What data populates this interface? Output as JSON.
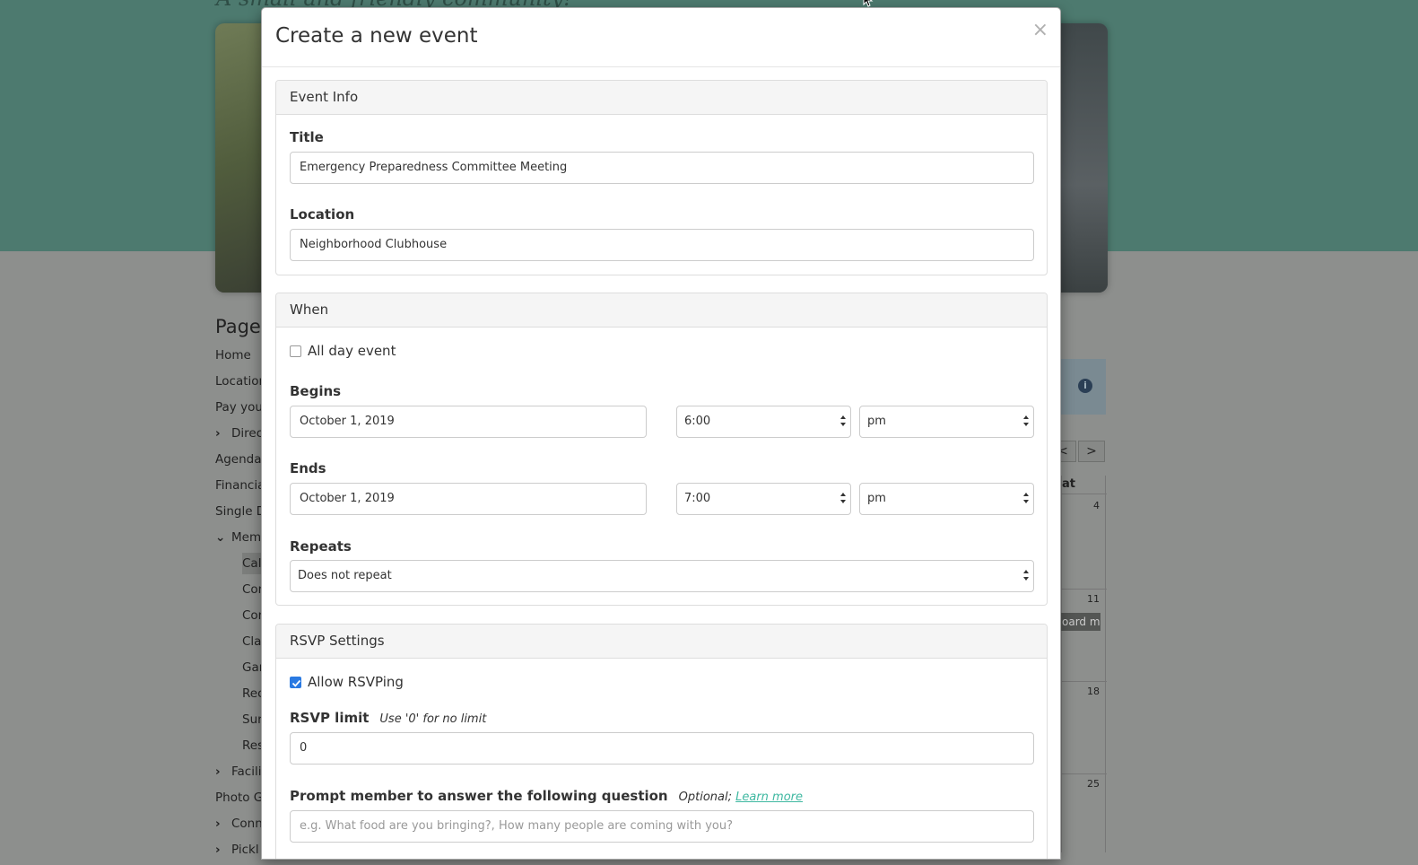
{
  "background": {
    "tagline": "A small and friendly community!",
    "pages_heading": "Pages",
    "nav": [
      {
        "label": "Home",
        "sub": false
      },
      {
        "label": "Locations",
        "sub": false
      },
      {
        "label": "Pay your",
        "sub": false
      },
      {
        "label": "Directory",
        "sub": false,
        "expander": "right"
      },
      {
        "label": "Agenda",
        "sub": false
      },
      {
        "label": "Financials",
        "sub": false
      },
      {
        "label": "Single D",
        "sub": false
      },
      {
        "label": "Members",
        "sub": false,
        "expander": "down"
      },
      {
        "label": "Calendar",
        "sub": true,
        "active": true
      },
      {
        "label": "Con",
        "sub": true
      },
      {
        "label": "Con",
        "sub": true
      },
      {
        "label": "Cla",
        "sub": true
      },
      {
        "label": "Gar",
        "sub": true
      },
      {
        "label": "Rec",
        "sub": true
      },
      {
        "label": "Sur",
        "sub": true
      },
      {
        "label": "Res",
        "sub": true
      },
      {
        "label": "Facilities",
        "sub": false,
        "expander": "right"
      },
      {
        "label": "Photo G",
        "sub": false
      },
      {
        "label": "Conn",
        "sub": false,
        "expander": "right"
      },
      {
        "label": "Pickl",
        "sub": false,
        "expander": "right"
      }
    ],
    "calendar": {
      "header_fragment": "at",
      "day_numbers": [
        "4",
        "11",
        "18",
        "25"
      ],
      "event_fragment": "oard me",
      "prev_label": "<",
      "next_label": ">"
    }
  },
  "modal": {
    "title": "Create a new event",
    "close_label": "×",
    "event_info": {
      "heading": "Event Info",
      "title_label": "Title",
      "title_value": "Emergency Preparedness Committee Meeting",
      "location_label": "Location",
      "location_value": "Neighborhood Clubhouse"
    },
    "when": {
      "heading": "When",
      "all_day_label": "All day event",
      "all_day_checked": false,
      "begins_label": "Begins",
      "begins_date": "October 1, 2019",
      "begins_time": "6:00",
      "begins_ampm": "pm",
      "ends_label": "Ends",
      "ends_date": "October 1, 2019",
      "ends_time": "7:00",
      "ends_ampm": "pm",
      "repeats_label": "Repeats",
      "repeats_value": "Does not repeat"
    },
    "rsvp": {
      "heading": "RSVP Settings",
      "allow_label": "Allow RSVPing",
      "allow_checked": true,
      "limit_label": "RSVP limit",
      "limit_hint": "Use '0' for no limit",
      "limit_value": "0",
      "question_label": "Prompt member to answer the following question",
      "question_hint": "Optional;",
      "learn_more": "Learn more",
      "question_placeholder": "e.g. What food are you bringing?, How many people are coming with you?"
    }
  },
  "colors": {
    "accent_link": "#3fb8a1",
    "checkbox_checked": "#2a7ae2",
    "overlay": "#8d8f8d",
    "header_band": "#4d7a6f"
  }
}
